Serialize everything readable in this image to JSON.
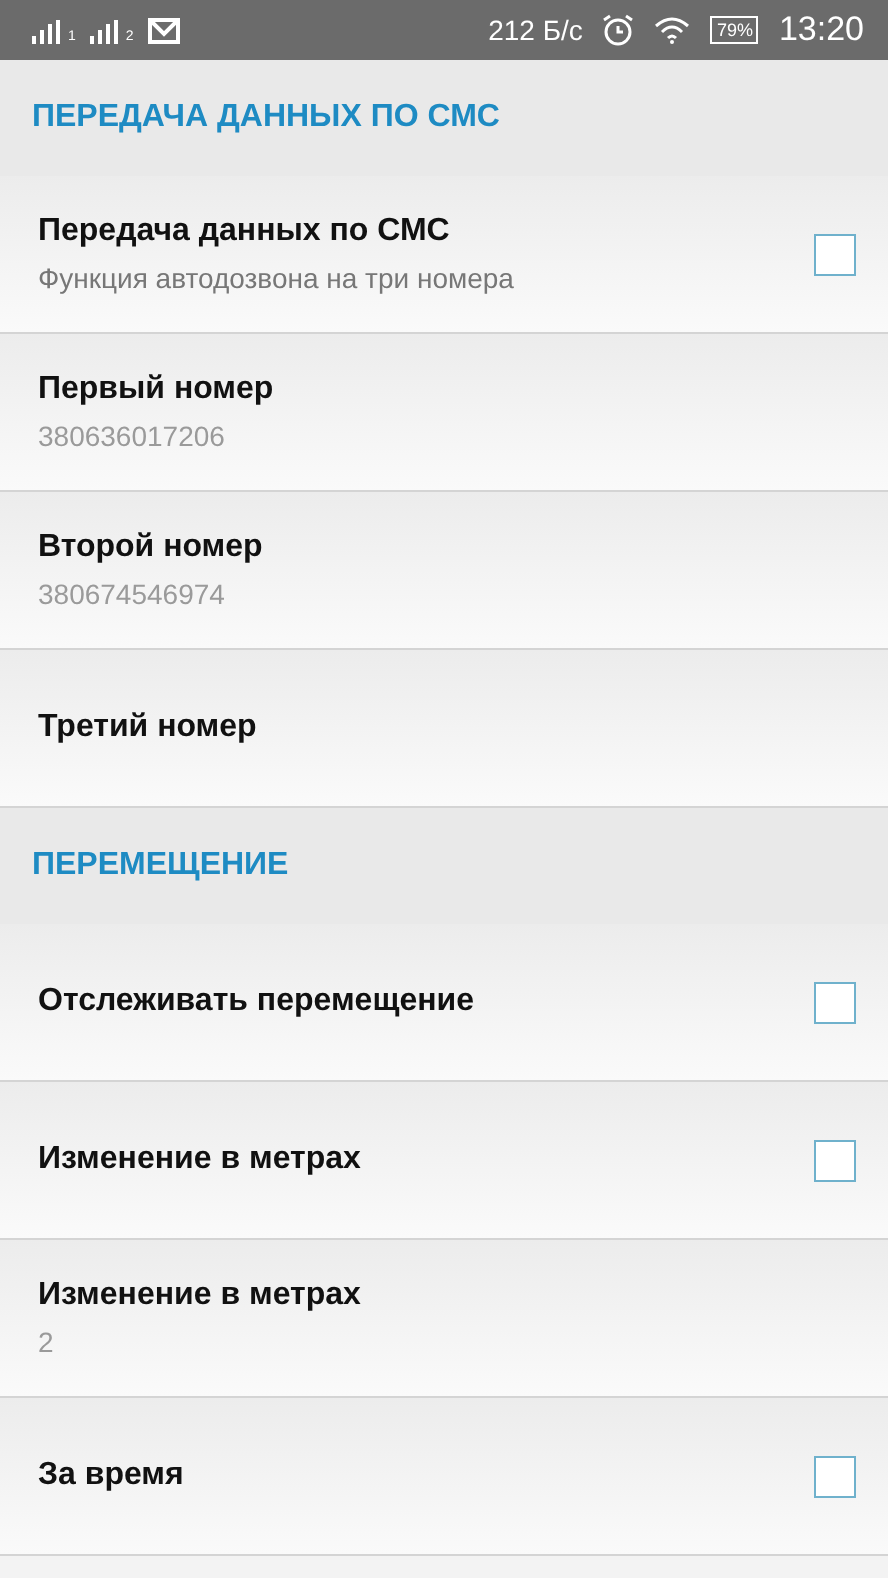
{
  "status_bar": {
    "sims": [
      "1",
      "2"
    ],
    "speed": "212 Б/с",
    "battery": "79%",
    "time": "13:20"
  },
  "sections": [
    {
      "title": "ПЕРЕДАЧА ДАННЫХ ПО СМС",
      "items": [
        {
          "kind": "checkbox",
          "title": "Передача данных по СМС",
          "summary": "Функция автодозвона на три номера",
          "checked": false
        },
        {
          "kind": "value",
          "title": "Первый номер",
          "value": "380636017206"
        },
        {
          "kind": "value",
          "title": "Второй номер",
          "value": "380674546974"
        },
        {
          "kind": "value",
          "title": "Третий номер"
        }
      ]
    },
    {
      "title": "ПЕРЕМЕЩЕНИЕ",
      "items": [
        {
          "kind": "checkbox",
          "title": "Отслеживать перемещение",
          "checked": false
        },
        {
          "kind": "checkbox",
          "title": "Изменение в метрах",
          "checked": false
        },
        {
          "kind": "value",
          "title": "Изменение в метрах",
          "value": "2"
        },
        {
          "kind": "checkbox",
          "title": "За время",
          "checked": false
        }
      ]
    }
  ]
}
